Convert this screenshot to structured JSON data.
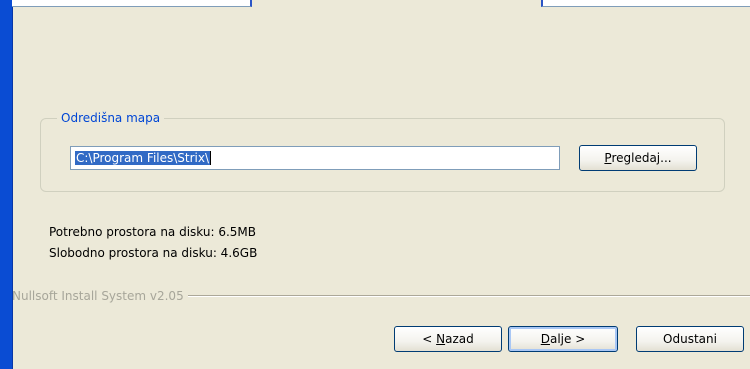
{
  "destination": {
    "group_label": "Odredišna mapa",
    "path_value": "C:\\Program Files\\Strix\\",
    "browse_prefix": "P",
    "browse_rest": "regledaj..."
  },
  "disk": {
    "required_text": "Potrebno prostora na disku: 6.5MB",
    "free_text": "Slobodno prostora na disku: 4.6GB"
  },
  "branding": {
    "text": "Nullsoft Install System v2.05"
  },
  "buttons": {
    "back_prefix": "< ",
    "back_hotkey": "N",
    "back_rest": "azad",
    "next_hotkey": "D",
    "next_rest": "alje >",
    "cancel_label": "Odustani"
  },
  "colors": {
    "window_frame": "#0a4cd3",
    "dialog_bg": "#ece9d8",
    "group_label": "#0046d5",
    "selection": "#316ac5"
  }
}
